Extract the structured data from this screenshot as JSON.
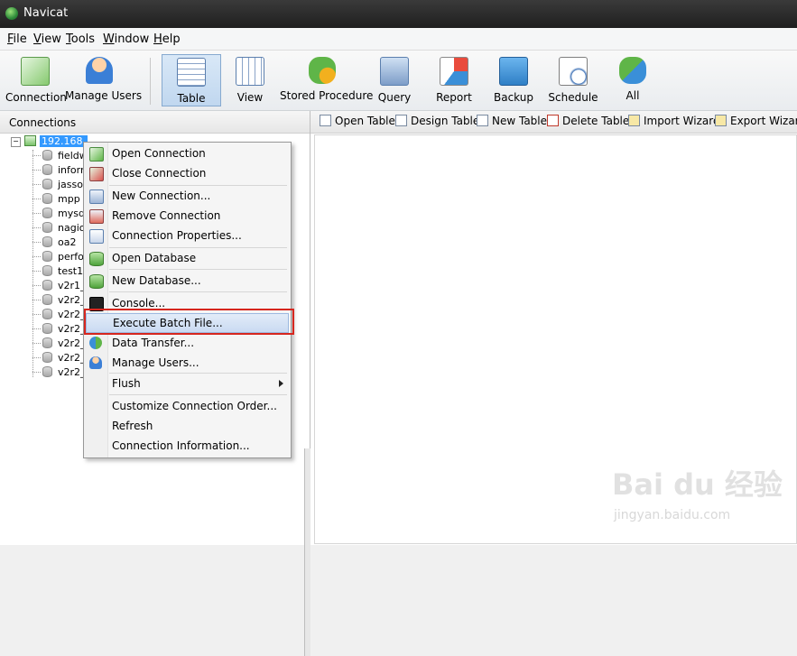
{
  "window": {
    "title": "Navicat"
  },
  "menu": [
    "File",
    "View",
    "Tools",
    "Window",
    "Help"
  ],
  "toolbar": [
    {
      "label": "Connection",
      "icon": "connection-icon"
    },
    {
      "label": "Manage Users",
      "icon": "user-icon"
    },
    {
      "label": "Table",
      "icon": "table-icon",
      "active": true
    },
    {
      "label": "View",
      "icon": "view-icon"
    },
    {
      "label": "Stored Procedure",
      "icon": "stored-procedure-icon"
    },
    {
      "label": "Query",
      "icon": "query-icon"
    },
    {
      "label": "Report",
      "icon": "report-icon"
    },
    {
      "label": "Backup",
      "icon": "backup-icon"
    },
    {
      "label": "Schedule",
      "icon": "schedule-icon"
    },
    {
      "label": "All",
      "icon": "all-icon"
    }
  ],
  "connections": {
    "header": "Connections",
    "connection_label": "192.168.",
    "databases": [
      "fieldw",
      "inform",
      "jasso",
      "mpp",
      "mysq",
      "nagio",
      "oa2",
      "perfo",
      "test1",
      "v2r1_",
      "v2r2_",
      "v2r2_",
      "v2r2_",
      "v2r2_",
      "v2r2_",
      "v2r2_"
    ]
  },
  "object_toolbar": [
    {
      "label": "Open Table",
      "accel": "O",
      "icon": "open-table-icon"
    },
    {
      "label": "Design Table",
      "accel": "D",
      "icon": "design-table-icon"
    },
    {
      "label": "New Table",
      "accel": "N",
      "icon": "new-table-icon"
    },
    {
      "label": "Delete Table",
      "accel": "D",
      "icon": "delete-table-icon"
    },
    {
      "label": "Import Wizard",
      "accel": "I",
      "icon": "import-wizard-icon"
    },
    {
      "label": "Export Wizard",
      "accel": "E",
      "icon": "export-wizard-icon"
    }
  ],
  "context_menu": [
    {
      "label": "Open Connection",
      "icon": "open-connection-icon"
    },
    {
      "label": "Close Connection",
      "icon": "close-connection-icon"
    },
    {
      "label": "New Connection...",
      "icon": "new-connection-icon"
    },
    {
      "label": "Remove Connection",
      "icon": "remove-connection-icon"
    },
    {
      "label": "Connection Properties...",
      "icon": "properties-icon"
    },
    {
      "label": "Open Database",
      "icon": "open-database-icon"
    },
    {
      "label": "New Database...",
      "icon": "new-database-icon"
    },
    {
      "label": "Console...",
      "icon": "console-icon"
    },
    {
      "label": "Execute Batch File...",
      "icon": "",
      "highlighted": true
    },
    {
      "label": "Data Transfer...",
      "icon": "data-transfer-icon"
    },
    {
      "label": "Manage Users...",
      "icon": "manage-users-icon"
    },
    {
      "label": "Flush",
      "icon": "",
      "submenu": true
    },
    {
      "label": "Customize Connection Order...",
      "icon": ""
    },
    {
      "label": "Refresh",
      "icon": ""
    },
    {
      "label": "Connection Information...",
      "icon": ""
    }
  ],
  "watermark": {
    "brand": "Bai du 经验",
    "url": "jingyan.baidu.com"
  },
  "colors": {
    "selection": "#3399ff",
    "highlight_box": "#d6261e",
    "menu_highlight": "#c9daf2"
  }
}
